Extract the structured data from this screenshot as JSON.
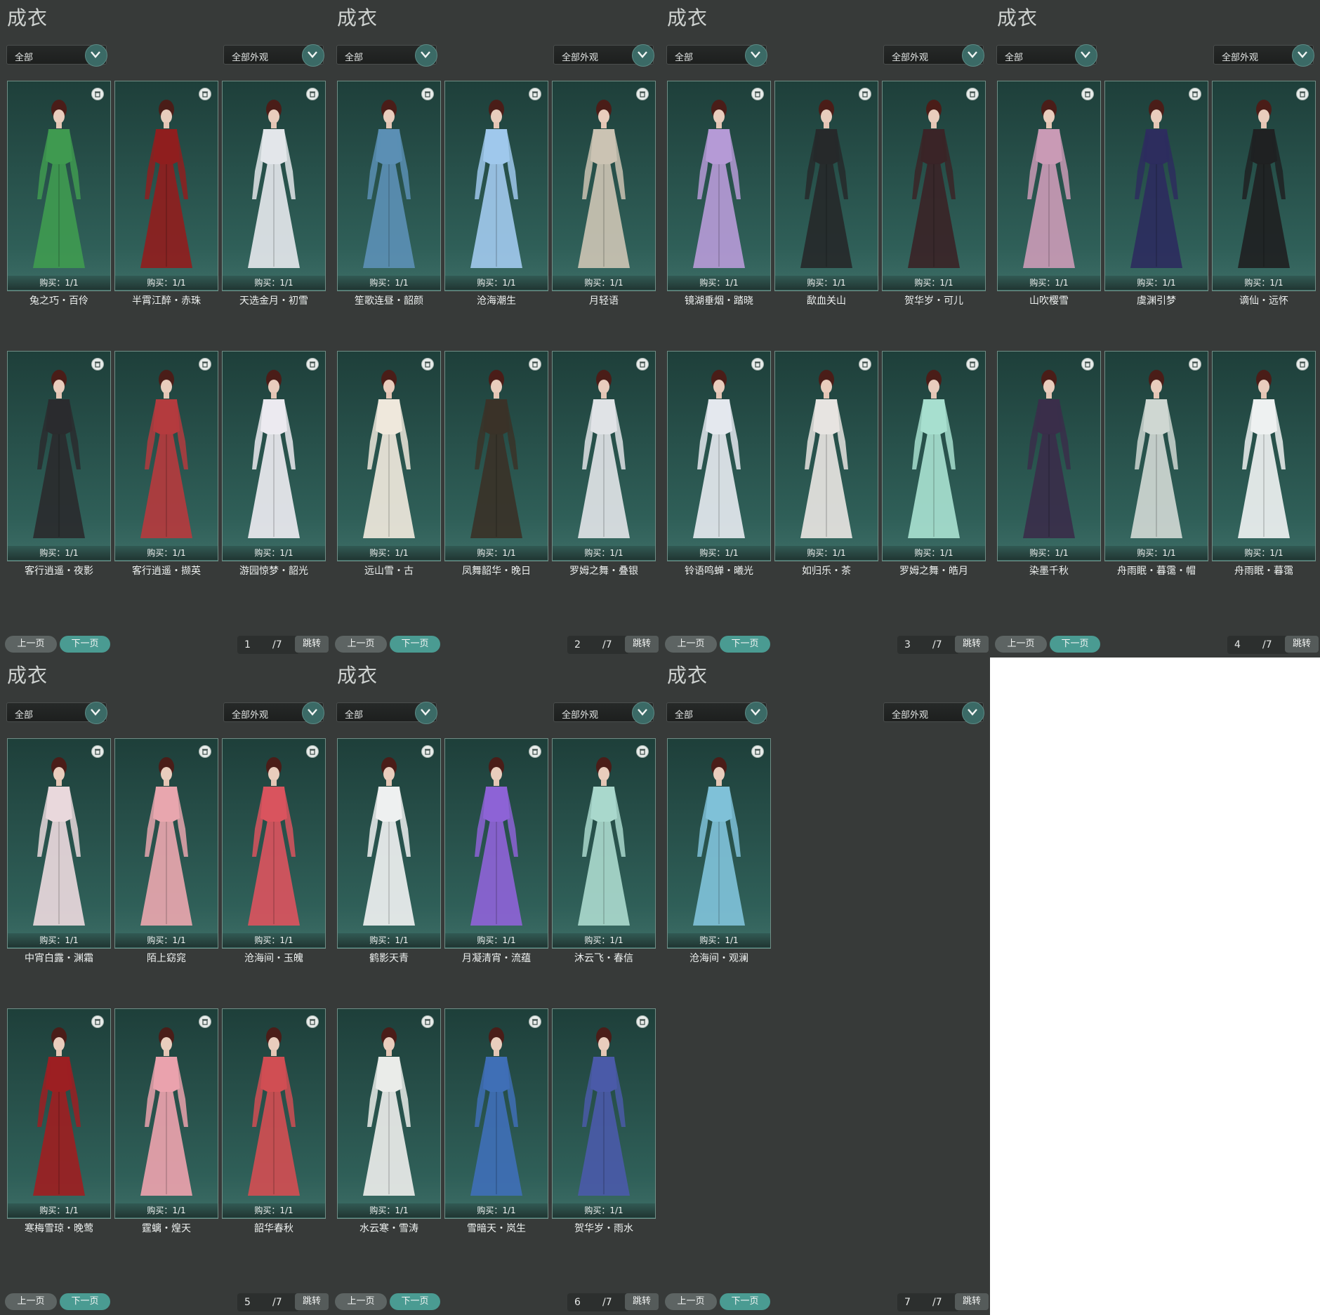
{
  "panels": [
    {
      "title": "成衣",
      "filter_left": "全部",
      "filter_right": "全部外观",
      "prev": "上一页",
      "next": "下一页",
      "page": "1",
      "total": "/7",
      "jump": "跳转",
      "items": [
        {
          "name": "兔之巧・百伶",
          "buy": "购买：1/1",
          "color": "#3f9a50"
        },
        {
          "name": "半霄江醉・赤珠",
          "buy": "购买：1/1",
          "color": "#8f1e1e"
        },
        {
          "name": "天选金月・初雪",
          "buy": "购买：1/1",
          "color": "#e3e6ea"
        },
        {
          "name": "客行逍遥・夜影",
          "buy": "购买：1/1",
          "color": "#2a2b2e"
        },
        {
          "name": "客行逍遥・撷英",
          "buy": "购买：1/1",
          "color": "#b43b3e"
        },
        {
          "name": "游园惊梦・韶光",
          "buy": "购买：1/1",
          "color": "#eceaf0"
        }
      ]
    },
    {
      "title": "成衣",
      "filter_left": "全部",
      "filter_right": "全部外观",
      "prev": "上一页",
      "next": "下一页",
      "page": "2",
      "total": "/7",
      "jump": "跳转",
      "items": [
        {
          "name": "笙歌连昼・韶颜",
          "buy": "购买：1/1",
          "color": "#5b8fb4"
        },
        {
          "name": "沧海潮生",
          "buy": "购买：1/1",
          "color": "#9fc8ec"
        },
        {
          "name": "月轻语",
          "buy": "购买：1/1",
          "color": "#cbc3b3"
        },
        {
          "name": "远山雪・古",
          "buy": "购买：1/1",
          "color": "#efe8dc"
        },
        {
          "name": "凤舞韶华・晚日",
          "buy": "购买：1/1",
          "color": "#3a3228"
        },
        {
          "name": "罗姆之舞・叠银",
          "buy": "购买：1/1",
          "color": "#e0e3e6"
        }
      ]
    },
    {
      "title": "成衣",
      "filter_left": "全部",
      "filter_right": "全部外观",
      "prev": "上一页",
      "next": "下一页",
      "page": "3",
      "total": "/7",
      "jump": "跳转",
      "items": [
        {
          "name": "镜湖垂烟・踏晓",
          "buy": "购买：1/1",
          "color": "#b59ad6"
        },
        {
          "name": "歃血关山",
          "buy": "购买：1/1",
          "color": "#26292a"
        },
        {
          "name": "贺华岁・可儿",
          "buy": "购买：1/1",
          "color": "#3a2427"
        },
        {
          "name": "铃语鸣蝉・曦光",
          "buy": "购买：1/1",
          "color": "#e4e8ee"
        },
        {
          "name": "如归乐・茶",
          "buy": "购买：1/1",
          "color": "#e7e4e1"
        },
        {
          "name": "罗姆之舞・皓月",
          "buy": "购买：1/1",
          "color": "#a7dfcf"
        }
      ]
    },
    {
      "title": "成衣",
      "filter_left": "全部",
      "filter_right": "全部外观",
      "prev": "上一页",
      "next": "下一页",
      "page": "4",
      "total": "/7",
      "jump": "跳转",
      "items": [
        {
          "name": "山吹樱雪",
          "buy": "购买：1/1",
          "color": "#c99ab5"
        },
        {
          "name": "虞渊引梦",
          "buy": "购买：1/1",
          "color": "#2d2d5e"
        },
        {
          "name": "谪仙・远怀",
          "buy": "购买：1/1",
          "color": "#1f2122"
        },
        {
          "name": "染墨千秋",
          "buy": "购买：1/1",
          "color": "#3a2e4a"
        },
        {
          "name": "舟雨眠・暮霭・帽",
          "buy": "购买：1/1",
          "color": "#cfd7d2"
        },
        {
          "name": "舟雨眠・暮霭",
          "buy": "购买：1/1",
          "color": "#eef1f1"
        }
      ]
    },
    {
      "title": "成衣",
      "filter_left": "全部",
      "filter_right": "全部外观",
      "prev": "上一页",
      "next": "下一页",
      "page": "5",
      "total": "/7",
      "jump": "跳转",
      "items": [
        {
          "name": "中宵白露・渊霜",
          "buy": "购买：1/1",
          "color": "#e9d8dc"
        },
        {
          "name": "陌上窈窕",
          "buy": "购买：1/1",
          "color": "#e8a6ae"
        },
        {
          "name": "沧海间・玉魄",
          "buy": "购买：1/1",
          "color": "#d9545e"
        },
        {
          "name": "寒梅雪琼・晚莺",
          "buy": "购买：1/1",
          "color": "#9c1f22"
        },
        {
          "name": "霆螭・煌天",
          "buy": "购买：1/1",
          "color": "#eaa2ad"
        },
        {
          "name": "韶华春秋",
          "buy": "购买：1/1",
          "color": "#d04e53"
        }
      ]
    },
    {
      "title": "成衣",
      "filter_left": "全部",
      "filter_right": "全部外观",
      "prev": "上一页",
      "next": "下一页",
      "page": "6",
      "total": "/7",
      "jump": "跳转",
      "items": [
        {
          "name": "鹤影天青",
          "buy": "购买：1/1",
          "color": "#eef0f0"
        },
        {
          "name": "月凝清宵・流蕴",
          "buy": "购买：1/1",
          "color": "#8d63d6"
        },
        {
          "name": "沐云飞・春信",
          "buy": "购买：1/1",
          "color": "#a9d8cc"
        },
        {
          "name": "水云寒・雪涛",
          "buy": "购买：1/1",
          "color": "#eaece9"
        },
        {
          "name": "雪暗天・岚生",
          "buy": "购买：1/1",
          "color": "#3f6fb6"
        },
        {
          "name": "贺华岁・雨水",
          "buy": "购买：1/1",
          "color": "#4a5aa8"
        }
      ]
    },
    {
      "title": "成衣",
      "filter_left": "全部",
      "filter_right": "全部外观",
      "prev": "上一页",
      "next": "下一页",
      "page": "7",
      "total": "/7",
      "jump": "跳转",
      "items": [
        {
          "name": "沧海间・观澜",
          "buy": "购买：1/1",
          "color": "#7fc1d8"
        }
      ]
    }
  ]
}
